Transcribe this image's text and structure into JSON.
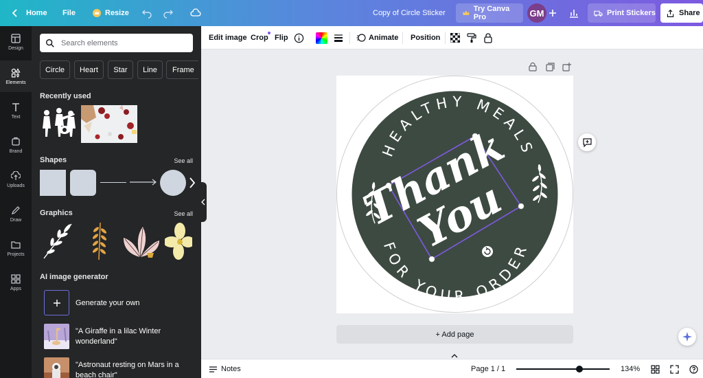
{
  "topbar": {
    "home": "Home",
    "file": "File",
    "resize": "Resize",
    "doc_title": "Copy of Circle Sticker",
    "try_pro": "Try Canva Pro",
    "avatar": "GM",
    "print": "Print Stickers",
    "share": "Share"
  },
  "rail": {
    "items": [
      {
        "label": "Design",
        "icon": "layout-icon"
      },
      {
        "label": "Elements",
        "icon": "elements-icon"
      },
      {
        "label": "Text",
        "icon": "text-icon"
      },
      {
        "label": "Brand",
        "icon": "brand-icon"
      },
      {
        "label": "Uploads",
        "icon": "upload-icon"
      },
      {
        "label": "Draw",
        "icon": "draw-icon"
      },
      {
        "label": "Projects",
        "icon": "folder-icon"
      },
      {
        "label": "Apps",
        "icon": "apps-icon"
      }
    ]
  },
  "panel": {
    "search_placeholder": "Search elements",
    "chips": [
      "Circle",
      "Heart",
      "Star",
      "Line",
      "Frame"
    ],
    "recently_used": "Recently used",
    "shapes": "Shapes",
    "graphics": "Graphics",
    "see_all": "See all",
    "ai_title": "AI image generator",
    "ai_generate": "Generate your own",
    "ai_items": [
      "\"A Giraffe in a lilac Winter wonderland\"",
      "\"Astronaut resting on Mars in a beach chair\""
    ]
  },
  "ctx": {
    "edit_image": "Edit image",
    "crop": "Crop",
    "flip": "Flip",
    "animate": "Animate",
    "position": "Position"
  },
  "sticker": {
    "top_text": "HEALTHY MEALS",
    "bottom_text": "FOR YOUR ORDER",
    "script_line1": "Thank",
    "script_line2": "You",
    "colors": {
      "circle": "#3d4a42",
      "accent": "#7d5ae0"
    }
  },
  "canvas": {
    "add_page": "+ Add page"
  },
  "bottom": {
    "notes": "Notes",
    "page": "Page 1 / 1",
    "zoom": "134%"
  }
}
